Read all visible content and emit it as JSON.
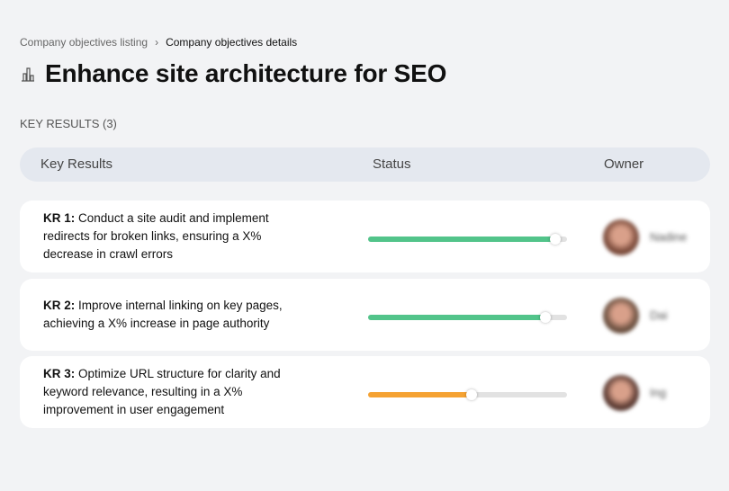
{
  "breadcrumb": {
    "items": [
      "Company objectives listing",
      "Company objectives details"
    ],
    "separator": "›"
  },
  "title": "Enhance site architecture for SEO",
  "title_icon": "building-chart-icon",
  "section_label": "KEY RESULTS (3)",
  "table": {
    "headers": [
      "Key Results",
      "Status",
      "Owner"
    ]
  },
  "key_results": [
    {
      "label": "KR 1:",
      "text": "Conduct a site audit and implement redirects for broken links, ensuring a X% decrease in crawl errors",
      "progress": 94,
      "color": "#52c48a",
      "owner": "Nadine",
      "avatar_color": "#7a4a3a"
    },
    {
      "label": "KR 2:",
      "text": "Improve internal linking on key pages, achieving a X% increase in page authority",
      "progress": 89,
      "color": "#52c48a",
      "owner": "Dai",
      "avatar_color": "#6b5040"
    },
    {
      "label": "KR 3:",
      "text": "Optimize URL structure for clarity and keyword relevance, resulting in a X% improvement in user engagement",
      "progress": 52,
      "color": "#f5a232",
      "owner": "Ing",
      "avatar_color": "#5a3a32"
    }
  ]
}
